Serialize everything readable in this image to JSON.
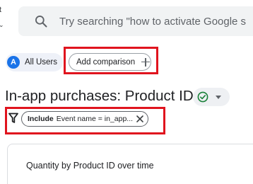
{
  "left_edge": {
    "fragment": "t"
  },
  "search": {
    "placeholder": "Try searching \"how to activate Google s"
  },
  "comparison": {
    "segment_avatar": "A",
    "segment_label": "All Users",
    "add_label": "Add comparison"
  },
  "report": {
    "title": "In-app purchases: Product ID"
  },
  "filter": {
    "include_label": "Include",
    "text": "Event name = in_app..."
  },
  "card": {
    "title": "Quantity by Product ID over time"
  },
  "colors": {
    "accent": "#1a73e8",
    "highlight": "#e0141e",
    "status_green": "#188038"
  }
}
